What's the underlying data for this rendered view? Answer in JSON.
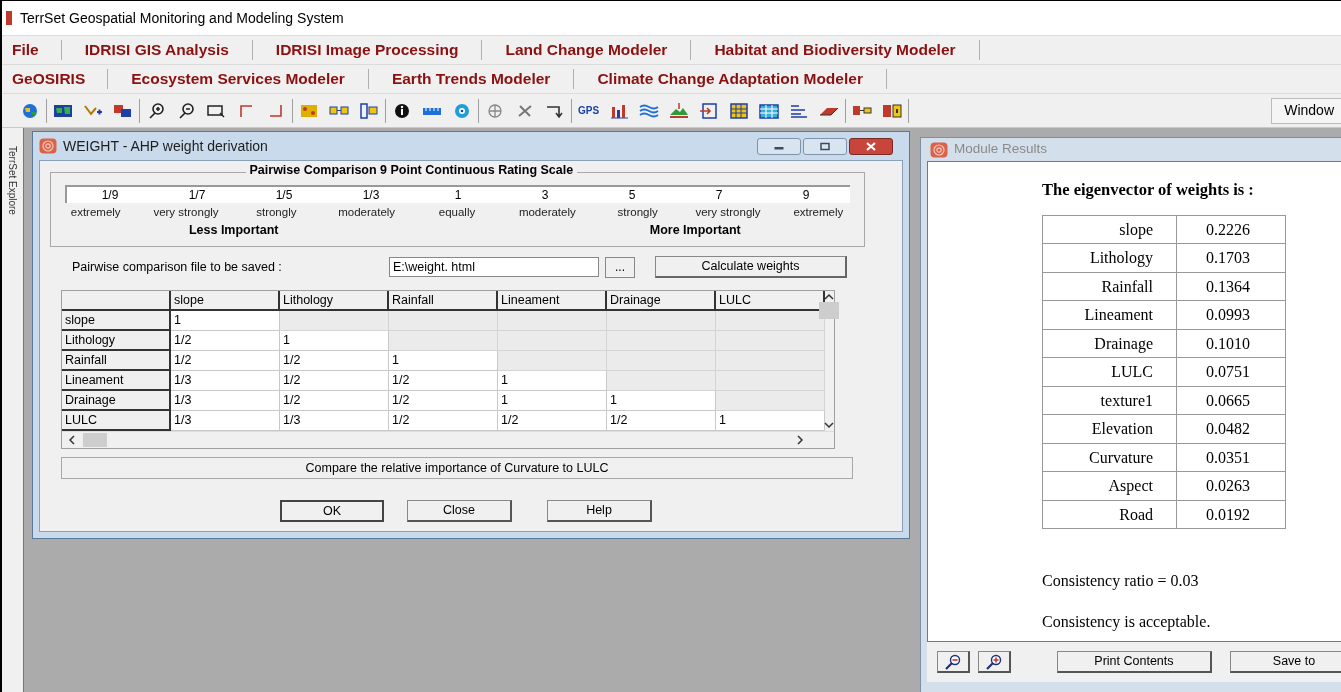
{
  "window": {
    "title": "TerrSet Geospatial Monitoring and Modeling System"
  },
  "menu_rows": [
    [
      "File",
      "IDRISI  GIS Analysis",
      "IDRISI  Image Processing",
      "Land Change Modeler",
      "Habitat and Biodiversity Modeler"
    ],
    [
      "GeOSIRIS",
      "Ecosystem Services Modeler",
      "Earth Trends Modeler",
      "Climate Change Adaptation Modeler"
    ]
  ],
  "toolbar": {
    "gps_label": "GPS",
    "window_button": "Window"
  },
  "explorer_tab": "TerrSet Explore",
  "dialog": {
    "title": "WEIGHT - AHP weight derivation",
    "scale": {
      "title": "Pairwise Comparison 9 Point Continuous Rating Scale",
      "points": [
        {
          "value": "1/9",
          "label": "extremely"
        },
        {
          "value": "1/7",
          "label": "very strongly"
        },
        {
          "value": "1/5",
          "label": "strongly"
        },
        {
          "value": "1/3",
          "label": "moderately"
        },
        {
          "value": "1",
          "label": "equally"
        },
        {
          "value": "3",
          "label": "moderately"
        },
        {
          "value": "5",
          "label": "strongly"
        },
        {
          "value": "7",
          "label": "very strongly"
        },
        {
          "value": "9",
          "label": "extremely"
        }
      ],
      "less_label": "Less Important",
      "more_label": "More Important"
    },
    "file_label": "Pairwise comparison file to be saved :",
    "file_value": "E:\\weight. html",
    "browse_button": "...",
    "calculate_button": "Calculate weights",
    "grid": {
      "columns": [
        "slope",
        "Lithology",
        "Rainfall",
        "Lineament",
        "Drainage",
        "LULC"
      ],
      "rows": [
        {
          "header": "slope",
          "values": [
            "1"
          ]
        },
        {
          "header": "Lithology",
          "values": [
            "1/2",
            "1"
          ]
        },
        {
          "header": "Rainfall",
          "values": [
            "1/2",
            "1/2",
            "1"
          ]
        },
        {
          "header": "Lineament",
          "values": [
            "1/3",
            "1/2",
            "1/2",
            "1"
          ]
        },
        {
          "header": "Drainage",
          "values": [
            "1/3",
            "1/2",
            "1/2",
            "1",
            "1"
          ]
        },
        {
          "header": "LULC",
          "values": [
            "1/3",
            "1/3",
            "1/2",
            "1/2",
            "1/2",
            "1"
          ]
        }
      ]
    },
    "status": "Compare the relative importance of Curvature to LULC",
    "buttons": [
      {
        "label": "OK",
        "default": true
      },
      {
        "label": "Close",
        "default": false
      },
      {
        "label": "Help",
        "default": false
      }
    ]
  },
  "results": {
    "title": "Module Results",
    "heading": "The eigenvector of weights is :",
    "weights": [
      {
        "name": "slope",
        "value": "0.2226"
      },
      {
        "name": "Lithology",
        "value": "0.1703"
      },
      {
        "name": "Rainfall",
        "value": "0.1364"
      },
      {
        "name": "Lineament",
        "value": "0.0993"
      },
      {
        "name": "Drainage",
        "value": "0.1010"
      },
      {
        "name": "LULC",
        "value": "0.0751"
      },
      {
        "name": "texture1",
        "value": "0.0665"
      },
      {
        "name": "Elevation",
        "value": "0.0482"
      },
      {
        "name": "Curvature",
        "value": "0.0351"
      },
      {
        "name": "Aspect",
        "value": "0.0263"
      },
      {
        "name": "Road",
        "value": "0.0192"
      }
    ],
    "ratio": "Consistency ratio = 0.03",
    "verdict": "Consistency is acceptable.",
    "print_button": "Print Contents",
    "save_button": "Save to"
  }
}
